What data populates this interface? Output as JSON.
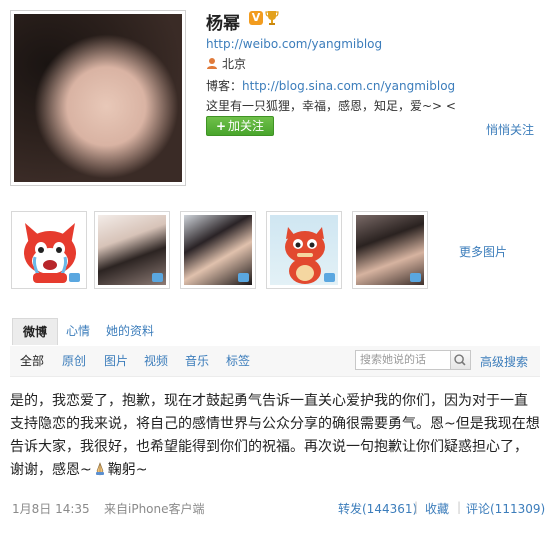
{
  "profile": {
    "name": "杨幂",
    "verified_badge": "V",
    "weibo_url": "http://weibo.com/yangmiblog",
    "location": "北京",
    "blog_label": "博客：",
    "blog_url": "http://blog.sina.com.cn/yangmiblog",
    "bio": "这里有一只狐狸，幸福，感恩，知足，爱~> <",
    "follow_plus": "+",
    "follow_label": "加关注",
    "quiet_follow": "悄悄关注",
    "more_photos": "更多图片"
  },
  "tabs": [
    "微博",
    "心情",
    "她的资料"
  ],
  "filters": [
    "全部",
    "原创",
    "图片",
    "视频",
    "音乐",
    "标签"
  ],
  "search": {
    "placeholder": "搜索她说的话",
    "advanced": "高级搜索"
  },
  "post": {
    "text_a": "是的，我恋爱了，抱歉，现在才鼓起勇气告诉一直关心爱护我的你们，因为对于一直支持隐恋的我来说，将自己的感情世界与公众分享的确很需要勇气。恩~但是我现在想告诉大家，我很好，也希望能得到你们的祝福。再次说一句抱歉让你们疑惑担心了，谢谢，感恩~",
    "emoticon": "pray-icon",
    "text_b": "鞠躬~",
    "time": "1月8日 14:35",
    "source": "来自iPhone客户端",
    "repost": "转发(144361)",
    "favorite": "收藏",
    "comment": "评论(111309)",
    "separator": "|"
  },
  "colors": {
    "link": "#3c7dbb",
    "follow_green": "#49a52c",
    "verified": "#f29c1f"
  }
}
